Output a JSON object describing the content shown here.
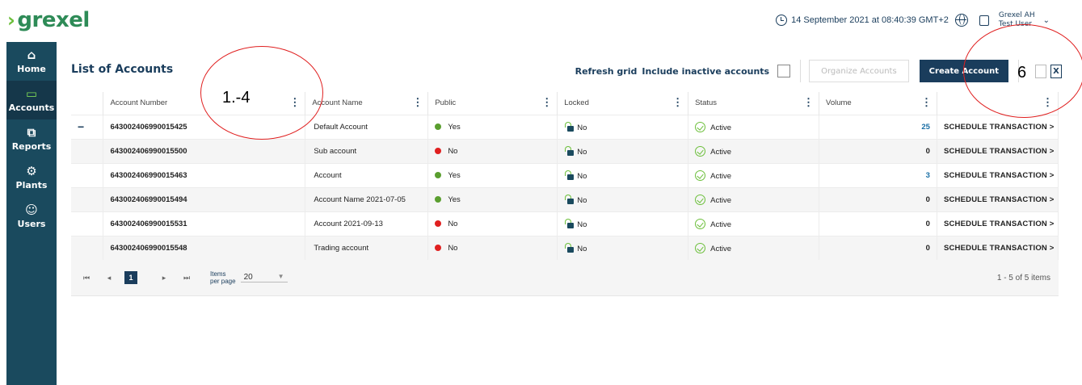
{
  "header": {
    "logo_text": "grexel",
    "datetime": "14 September 2021 at 08:40:39 GMT+2",
    "user_org": "Grexel AH",
    "user_name": "Test User"
  },
  "sidebar": {
    "items": [
      {
        "label": "Home",
        "icon": "home-icon",
        "glyph": "⌂"
      },
      {
        "label": "Accounts",
        "icon": "folder-icon",
        "glyph": "▭"
      },
      {
        "label": "Reports",
        "icon": "reports-icon",
        "glyph": "⧉"
      },
      {
        "label": "Plants",
        "icon": "plants-icon",
        "glyph": "⚙"
      },
      {
        "label": "Users",
        "icon": "users-icon",
        "glyph": "☺"
      }
    ]
  },
  "main": {
    "title": "List of Accounts",
    "refresh_label": "Refresh grid",
    "include_inactive_label": "Include inactive accounts",
    "organize_label": "Organize Accounts",
    "create_label": "Create Account",
    "xls_label": "X"
  },
  "grid": {
    "columns": [
      "Account Number",
      "Account Name",
      "Public",
      "Locked",
      "Status",
      "Volume",
      ""
    ],
    "rows": [
      {
        "number": "643002406990015425",
        "name": "Default Account",
        "public": "Yes",
        "locked": "No",
        "status": "Active",
        "volume": "25",
        "action": "SCHEDULE TRANSACTION >"
      },
      {
        "number": "643002406990015500",
        "name": "Sub account",
        "public": "No",
        "locked": "No",
        "status": "Active",
        "volume": "0",
        "action": "SCHEDULE TRANSACTION >"
      },
      {
        "number": "643002406990015463",
        "name": "Account",
        "public": "Yes",
        "locked": "No",
        "status": "Active",
        "volume": "3",
        "action": "SCHEDULE TRANSACTION >"
      },
      {
        "number": "643002406990015494",
        "name": "Account Name 2021-07-05",
        "public": "Yes",
        "locked": "No",
        "status": "Active",
        "volume": "0",
        "action": "SCHEDULE TRANSACTION >"
      },
      {
        "number": "643002406990015531",
        "name": "Account 2021-09-13",
        "public": "No",
        "locked": "No",
        "status": "Active",
        "volume": "0",
        "action": "SCHEDULE TRANSACTION >"
      },
      {
        "number": "643002406990015548",
        "name": "Trading account",
        "public": "No",
        "locked": "No",
        "status": "Active",
        "volume": "0",
        "action": "SCHEDULE TRANSACTION >"
      }
    ]
  },
  "pager": {
    "first": "⏮",
    "prev": "◂",
    "current_page": "1",
    "next": "▸",
    "last": "⏭",
    "items_label": "Items",
    "per_page_label": "per page",
    "per_page_value": "20",
    "info": "1 - 5 of 5 items"
  },
  "annotations": {
    "label_1": "1.-4",
    "label_2": "6"
  },
  "colors": {
    "brand_green": "#6cbf3b",
    "navy": "#1a3d5c",
    "sidebar": "#1a4a5e",
    "yes_dot": "#5a9e2f",
    "no_dot": "#e02020"
  }
}
